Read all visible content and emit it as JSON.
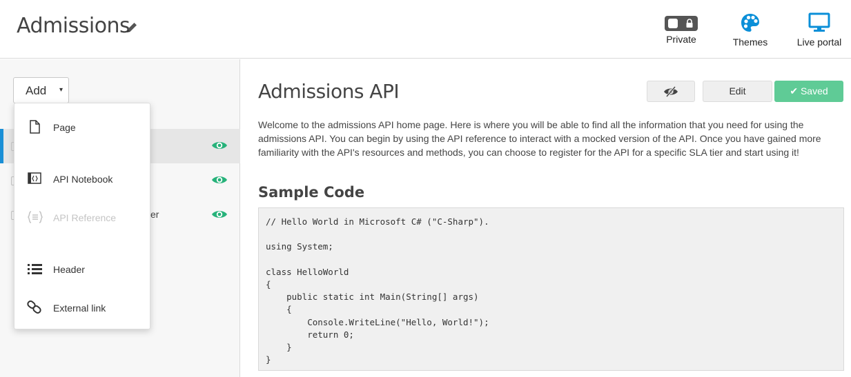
{
  "header": {
    "title": "Admissions",
    "tools": [
      {
        "label": "Private",
        "icon": "lock-toggle-icon"
      },
      {
        "label": "Themes",
        "icon": "palette-icon"
      },
      {
        "label": "Live portal",
        "icon": "monitor-icon"
      }
    ]
  },
  "sidebar": {
    "add_label": "Add",
    "add_caret": "▾",
    "rows": [
      {
        "tail": "",
        "visible": true,
        "active": true
      },
      {
        "tail": "",
        "visible": true,
        "active": false
      },
      {
        "tail": "er",
        "visible": true,
        "active": false
      }
    ]
  },
  "dropdown": {
    "items": [
      {
        "label": "Page",
        "icon": "page-icon",
        "enabled": true
      },
      {
        "label": "API Notebook",
        "icon": "notebook-icon",
        "enabled": true
      },
      {
        "label": "API Reference",
        "icon": "api-reference-icon",
        "enabled": false
      },
      {
        "label": "Header",
        "icon": "list-icon",
        "enabled": true
      },
      {
        "label": "External link",
        "icon": "link-icon",
        "enabled": true
      }
    ]
  },
  "main": {
    "title": "Admissions API",
    "edit_label": "Edit",
    "saved_label": "✔ Saved",
    "intro": "Welcome to the admissions API home page. Here is where you will be able to find all the information that you need for using the admissions API. You can begin by using the API reference to interact with a mocked version of the API. Once you have gained more familiarity with the API's resources and methods, you can choose to register for the API for a specific SLA tier and start using it!",
    "section_title": "Sample Code",
    "code": "// Hello World in Microsoft C# (\"C-Sharp\").\n\nusing System;\n\nclass HelloWorld\n{\n    public static int Main(String[] args)\n    {\n        Console.WriteLine(\"Hello, World!\");\n        return 0;\n    }\n}"
  },
  "colors": {
    "accent_blue": "#1a8fd6",
    "saved_green": "#5fcb96",
    "eye_green": "#27b27a"
  }
}
